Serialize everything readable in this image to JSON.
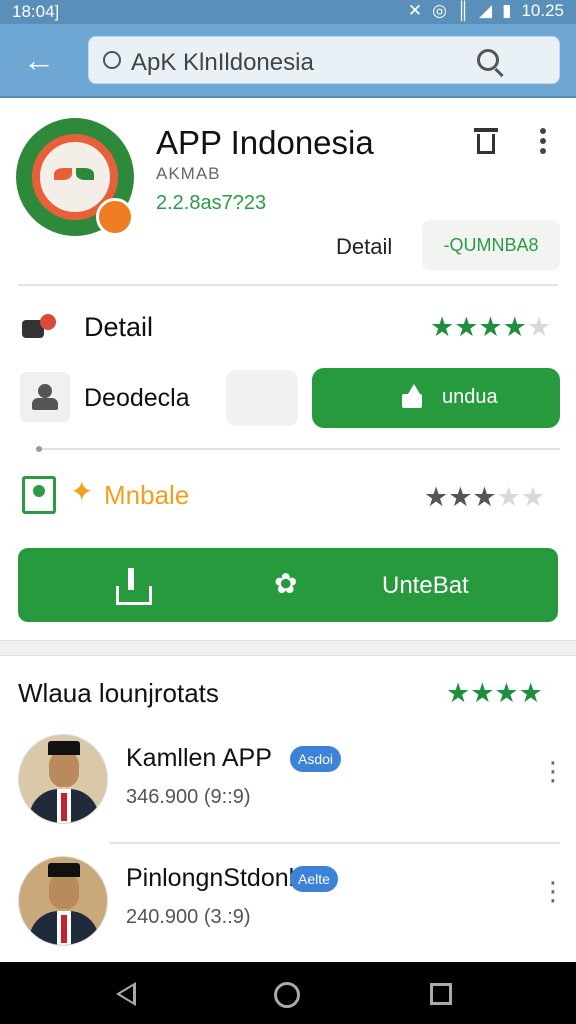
{
  "status_bar": {
    "time": "18:04]",
    "right_time": "10.25",
    "icons": [
      "bluetooth-off-icon",
      "alarm-icon",
      "vibrate-icon",
      "signal-icon",
      "battery-icon"
    ]
  },
  "header": {
    "search_text": "ApK KlnIldonesia",
    "icons": [
      "back-arrow-icon",
      "search-icon"
    ]
  },
  "app": {
    "title": "APP Indonesia",
    "developer": "AKMAB",
    "version": "2.2.8as7?23",
    "detail_link": "Detail",
    "install_chip": "-QUMNBA8",
    "accent": "#2e9a46"
  },
  "detail_row": {
    "label": "Detail",
    "rating": 4,
    "rating_max": 5
  },
  "dependency_row": {
    "label": "Deodecla",
    "download_label": "undua"
  },
  "mobile_row": {
    "label": "Mnbale",
    "rating": 3,
    "rating_max": 5
  },
  "big_button": {
    "label": "UnteBat"
  },
  "section": {
    "title": "Wlaua lounjrotats",
    "rating": 4
  },
  "list_items": [
    {
      "name": "Kamllen APP",
      "badge": "Asdoi",
      "meta": "346.900 (9::9)"
    },
    {
      "name": "PinlongnStdonl",
      "badge": "Aelte",
      "meta": "240.900 (3.:9)"
    }
  ],
  "colors": {
    "header": "#6ea7d4",
    "green": "#269a3c",
    "badge_blue": "#3b82d8",
    "orange": "#f0a11c"
  }
}
